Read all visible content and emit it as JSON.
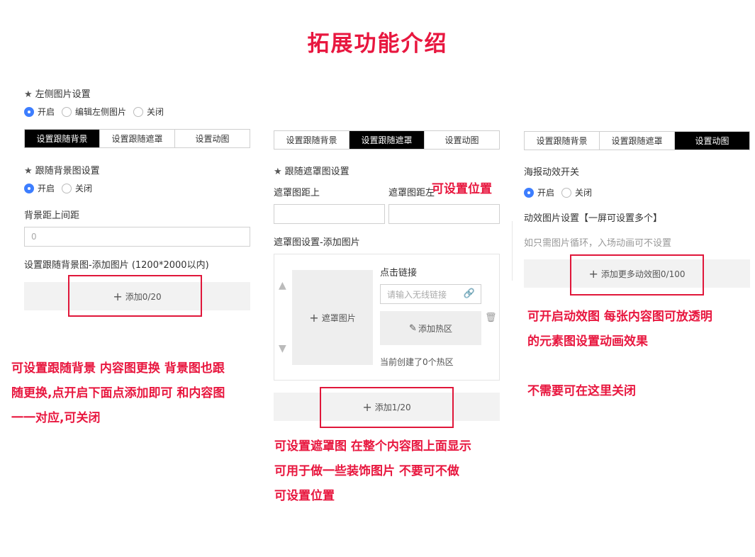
{
  "title": "拓展功能介绍",
  "col1": {
    "left_image_heading": "左侧图片设置",
    "left_image_options": [
      "开启",
      "编辑左侧图片",
      "关闭"
    ],
    "tabs": [
      "设置跟随背景",
      "设置跟随遮罩",
      "设置动图"
    ],
    "bg_heading": "跟随背景图设置",
    "bg_options": [
      "开启",
      "关闭"
    ],
    "bg_top_spacing_label": "背景距上间距",
    "bg_top_spacing_value": "0",
    "bg_add_image_label": "设置跟随背景图-添加图片 (1200*2000以内)",
    "add_button": "添加0/20"
  },
  "col2": {
    "tabs": [
      "设置跟随背景",
      "设置跟随遮罩",
      "设置动图"
    ],
    "mask_heading": "跟随遮罩图设置",
    "mask_top_label": "遮罩图距上",
    "mask_left_label": "遮罩图距左",
    "mask_add_image_label": "遮罩图设置-添加图片",
    "mask_image_placeholder": "遮罩图片",
    "click_link_label": "点击链接",
    "link_placeholder": "请输入无线链接",
    "hotspot_button": "添加热区",
    "hotspot_count": "当前创建了0个热区",
    "add_button": "添加1/20"
  },
  "col3": {
    "tabs": [
      "设置跟随背景",
      "设置跟随遮罩",
      "设置动图"
    ],
    "anim_switch_label": "海报动效开关",
    "anim_options": [
      "开启",
      "关闭"
    ],
    "anim_image_label": "动效图片设置【一屏可设置多个】",
    "anim_hint": "如只需图片循环，入场动画可不设置",
    "add_button": "添加更多动效图0/100"
  },
  "annotations": {
    "position_note": "可设置位置",
    "col1_note": [
      "可设置跟随背景 内容图更换 背景图也跟",
      "随更换,点开启下面点添加即可 和内容图",
      "一一对应,可关闭"
    ],
    "col2_note": [
      "可设置遮罩图 在整个内容图上面显示",
      "可用于做一些装饰图片 不要可不做",
      "可设置位置"
    ],
    "col3_note": [
      "可开启动效图 每张内容图可放透明",
      "的元素图设置动画效果"
    ],
    "col3_note2": "不需要可在这里关闭"
  },
  "colors": {
    "accent_red": "#e8173f",
    "radio_blue": "#3d7eff",
    "tab_active": "#000000"
  }
}
